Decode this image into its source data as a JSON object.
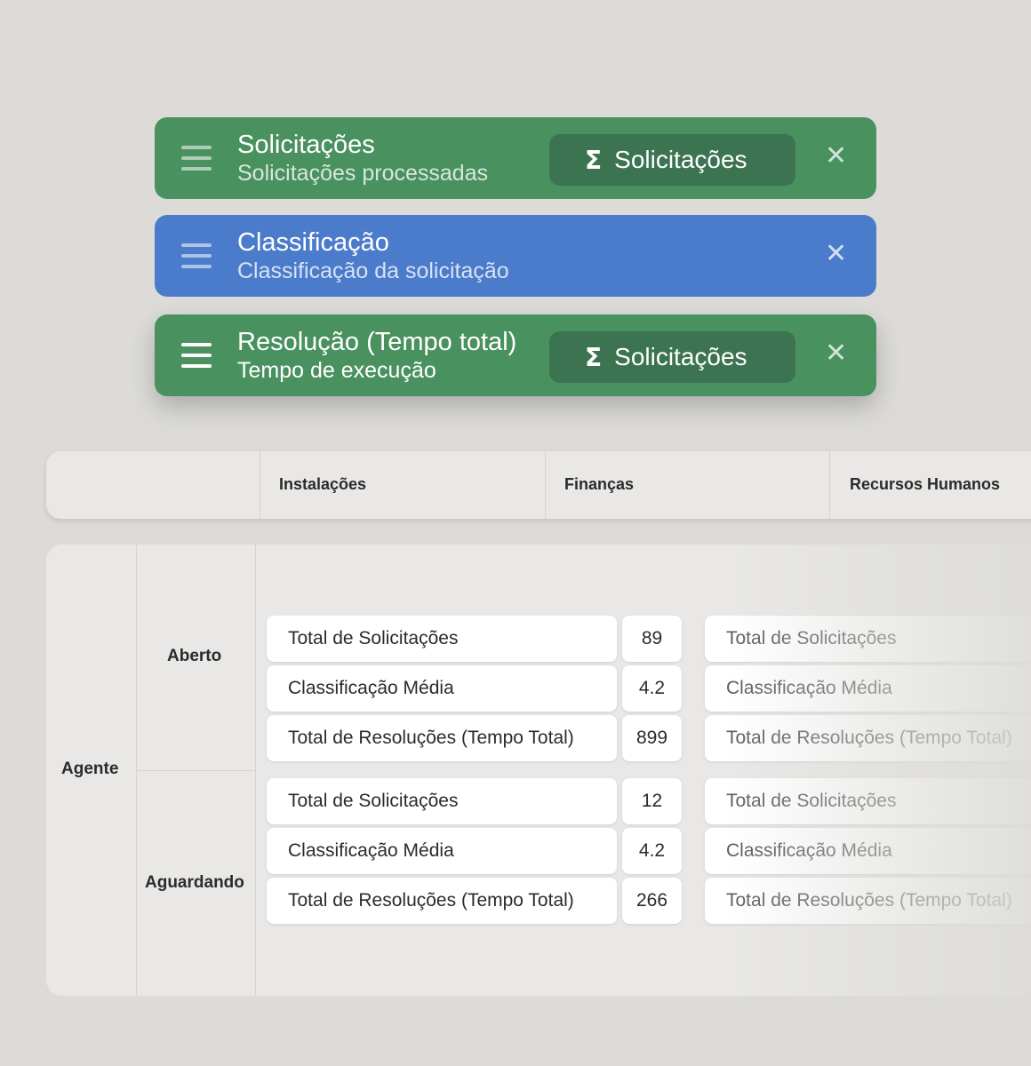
{
  "fields": [
    {
      "title": "Solicitações",
      "subtitle": "Solicitações processadas",
      "aggregation": {
        "symbol": "Σ",
        "label": "Solicitações"
      },
      "color": "#4a9160"
    },
    {
      "title": "Classificação",
      "subtitle": "Classificação da solicitação",
      "color": "#4b7bcb"
    },
    {
      "title": "Resolução (Tempo total)",
      "subtitle": "Tempo de execução",
      "aggregation": {
        "symbol": "Σ",
        "label": "Solicitações"
      },
      "color": "#4a9160"
    }
  ],
  "close_symbol": "✕",
  "columns": [
    "Instalações",
    "Finanças",
    "Recursos Humanos"
  ],
  "pivot": {
    "row_header": "Agente",
    "groups": [
      {
        "label": "Aberto",
        "rows": [
          {
            "metric": "Total de Solicitações",
            "value": "89"
          },
          {
            "metric": "Classificação Média",
            "value": "4.2"
          },
          {
            "metric": "Total de Resoluções (Tempo Total)",
            "value": "899"
          }
        ]
      },
      {
        "label": "Aguardando",
        "rows": [
          {
            "metric": "Total de Solicitações",
            "value": "12"
          },
          {
            "metric": "Classificação Média",
            "value": "4.2"
          },
          {
            "metric": "Total de Resoluções (Tempo Total)",
            "value": "266"
          }
        ]
      }
    ]
  }
}
